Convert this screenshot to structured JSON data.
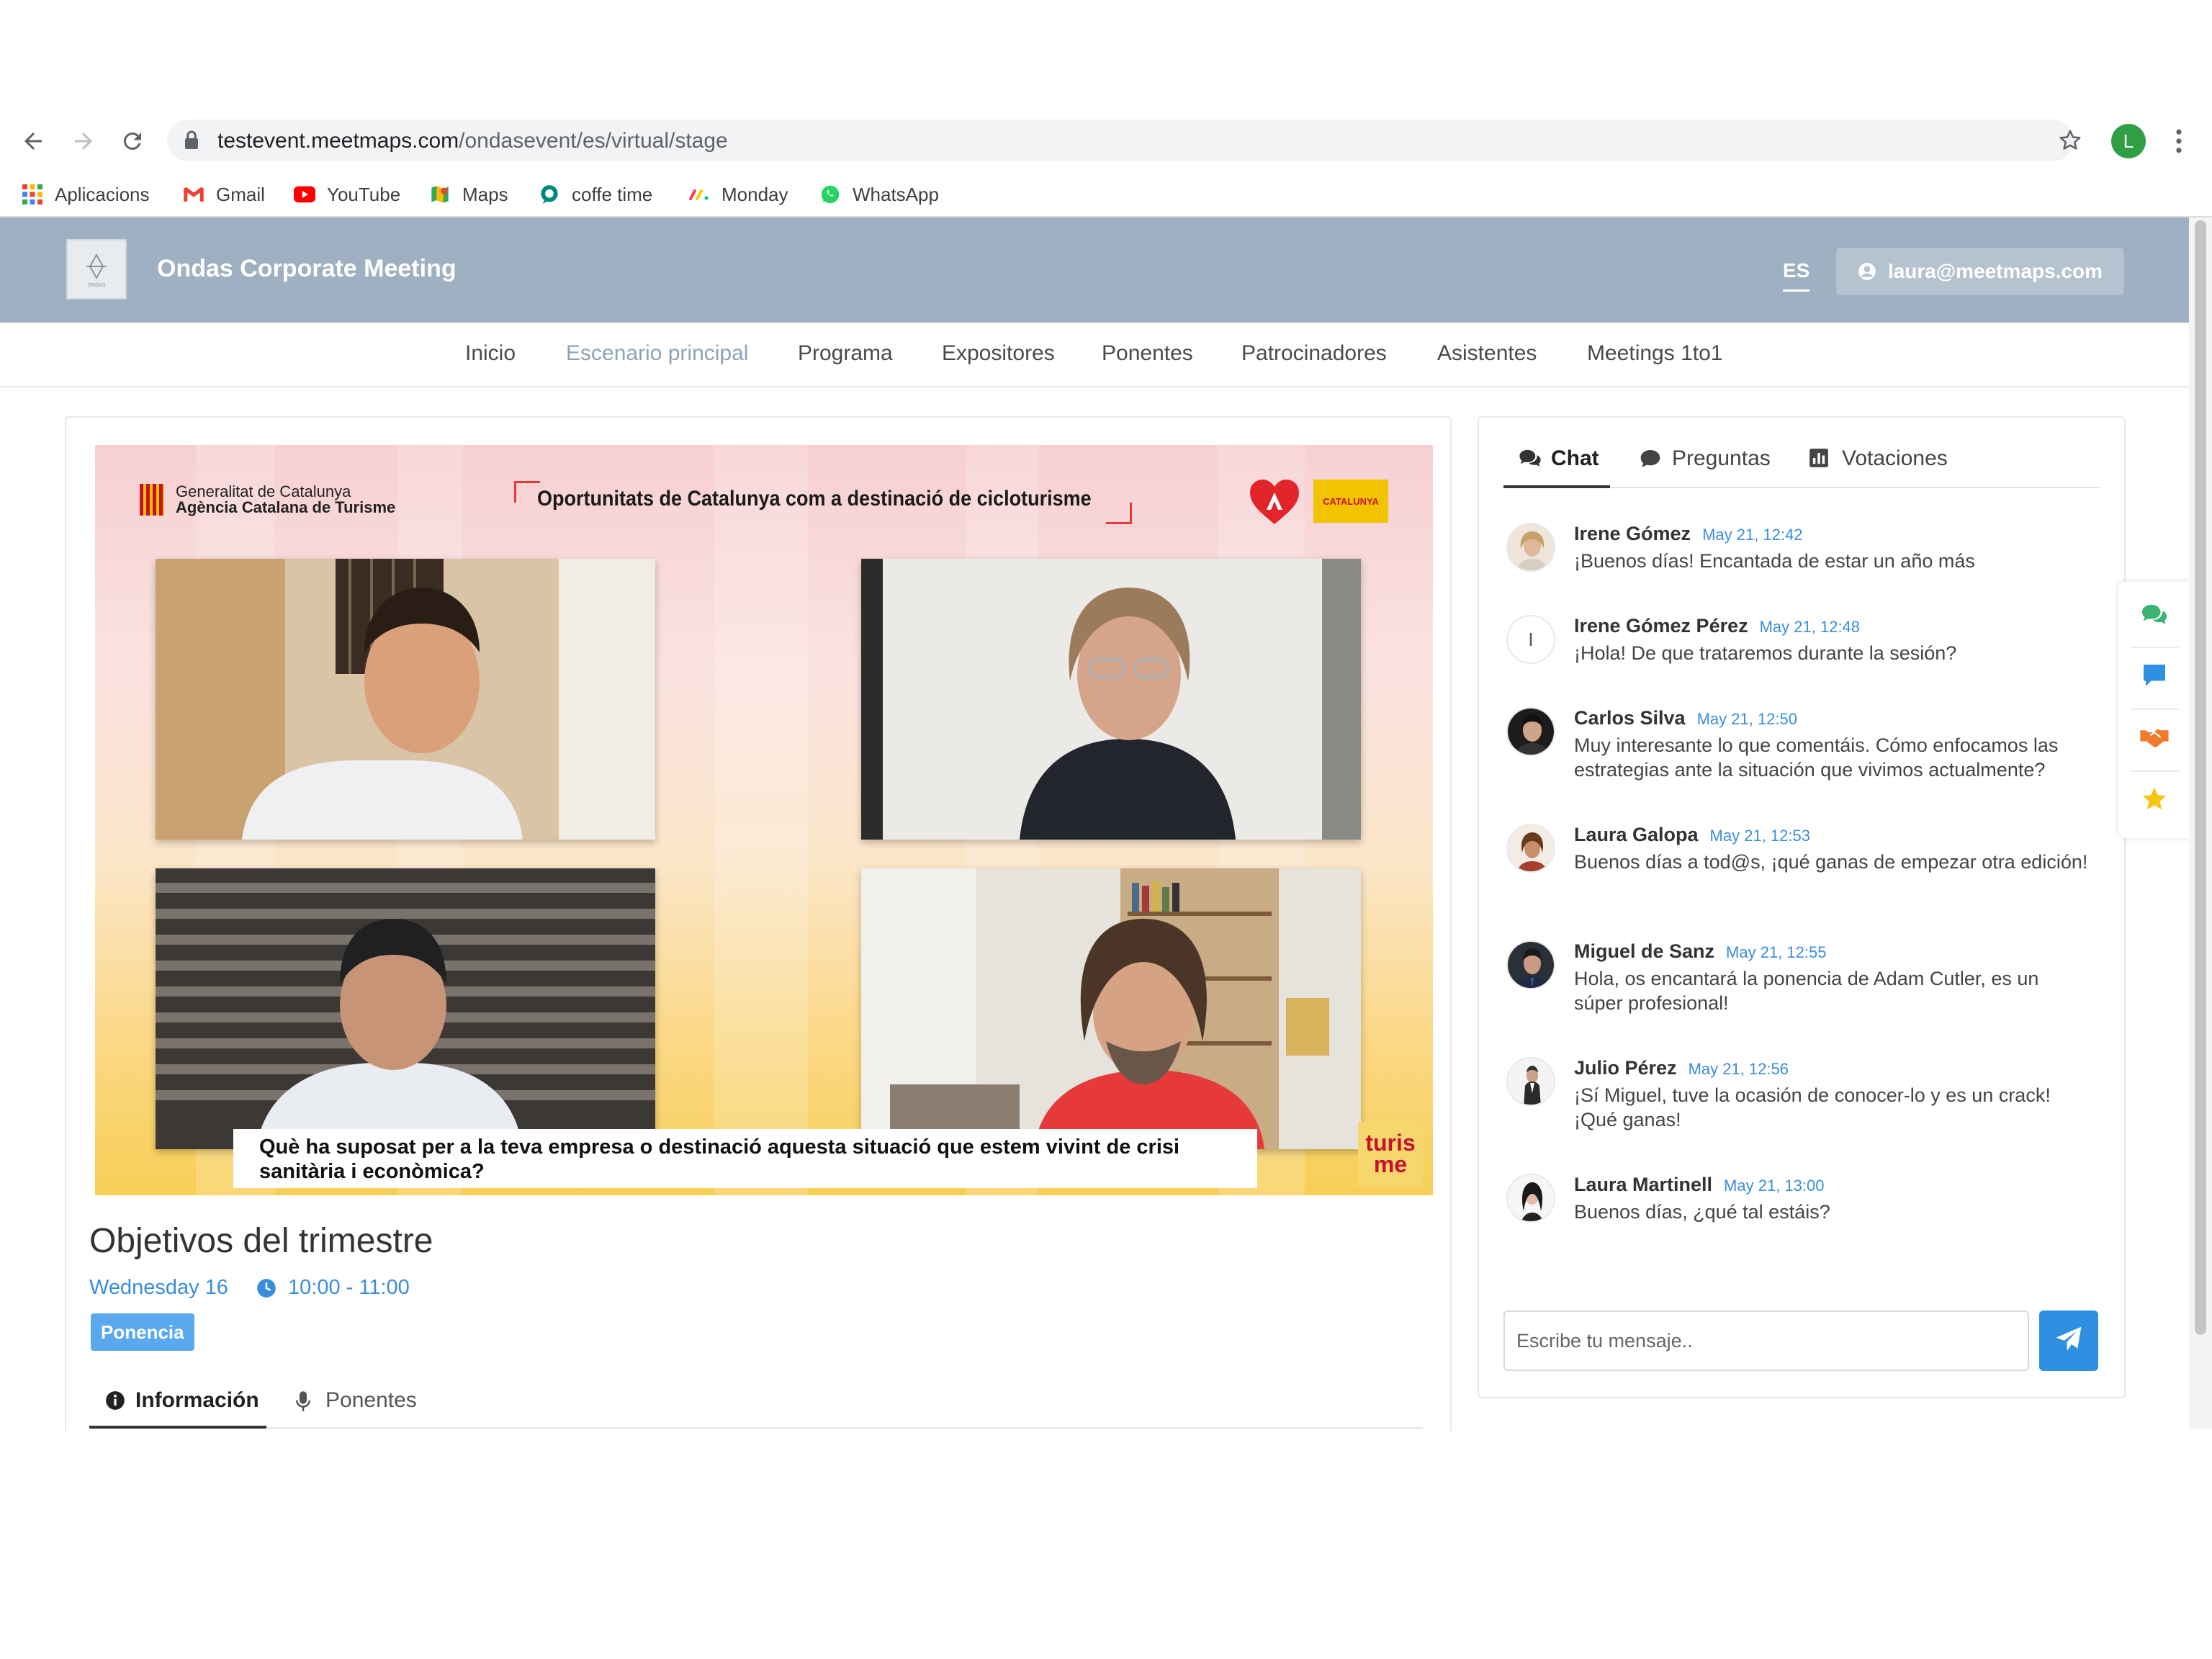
{
  "browser": {
    "url_host": "testevent.meetmaps.com",
    "url_path": "/ondasevent/es/virtual/stage",
    "profile_initial": "L",
    "bookmarks": [
      {
        "label": "Aplicacions",
        "icon": "apps-grid-icon"
      },
      {
        "label": "Gmail",
        "icon": "gmail-icon"
      },
      {
        "label": "YouTube",
        "icon": "youtube-icon"
      },
      {
        "label": "Maps",
        "icon": "maps-icon"
      },
      {
        "label": "coffe time",
        "icon": "meet-icon"
      },
      {
        "label": "Monday",
        "icon": "monday-icon"
      },
      {
        "label": "WhatsApp",
        "icon": "whatsapp-icon"
      }
    ]
  },
  "header": {
    "event_title": "Ondas Corporate Meeting",
    "logo_text": "ONDAS",
    "language": "ES",
    "user_email": "laura@meetmaps.com"
  },
  "nav": {
    "items": [
      "Inicio",
      "Escenario principal",
      "Programa",
      "Expositores",
      "Ponentes",
      "Patrocinadores",
      "Asistentes",
      "Meetings 1to1"
    ],
    "active": "Escenario principal"
  },
  "video": {
    "org_line1": "Generalitat de Catalunya",
    "org_line2": "Agència Catalana de Turisme",
    "title": "Oportunitats de Catalunya com a destinació de cicloturisme",
    "catalunya_badge": "CATALUNYA",
    "caption": "Què ha suposat per a la teva empresa o destinació aquesta situació que estem vivint de crisi sanitària i econòmica?",
    "brand_line1": "turis",
    "brand_line2": "me"
  },
  "session": {
    "title": "Objetivos del trimestre",
    "date": "Wednesday 16",
    "time": "10:00 - 11:00",
    "badge": "Ponencia",
    "tabs": [
      "Información",
      "Ponentes"
    ]
  },
  "chat": {
    "tabs": [
      "Chat",
      "Preguntas",
      "Votaciones"
    ],
    "messages": [
      {
        "name": "Irene Gómez",
        "time": "May 21, 12:42",
        "text": "¡Buenos días! Encantada de estar un año más"
      },
      {
        "name": "Irene Gómez Pérez",
        "time": "May 21, 12:48",
        "text": "¡Hola! De que trataremos durante la sesión?",
        "initial": "I"
      },
      {
        "name": "Carlos Silva",
        "time": "May 21, 12:50",
        "text": "Muy interesante lo que comentáis. Cómo enfocamos las estrategias ante la situación que vivimos actualmente?"
      },
      {
        "name": "Laura Galopa",
        "time": "May 21, 12:53",
        "text": "Buenos días a tod@s, ¡qué ganas de empezar otra edición!"
      },
      {
        "name": "Miguel de Sanz",
        "time": "May 21, 12:55",
        "text": "Hola, os encantará la ponencia de Adam Cutler, es un súper profesional!"
      },
      {
        "name": "Julio Pérez",
        "time": "May 21, 12:56",
        "text": "¡Sí Miguel, tuve la ocasión de conocer-lo y es un crack! ¡Qué ganas!"
      },
      {
        "name": "Laura Martinell",
        "time": "May 21, 13:00",
        "text": "Buenos días, ¿qué tal estáis?"
      }
    ],
    "input_placeholder": "Escribe tu mensaje.."
  },
  "colors": {
    "header_bg": "#9eb0c1",
    "accent_blue": "#3a8ddc",
    "send_button": "#2f8fe0",
    "badge_bg": "#5aa9ee"
  }
}
